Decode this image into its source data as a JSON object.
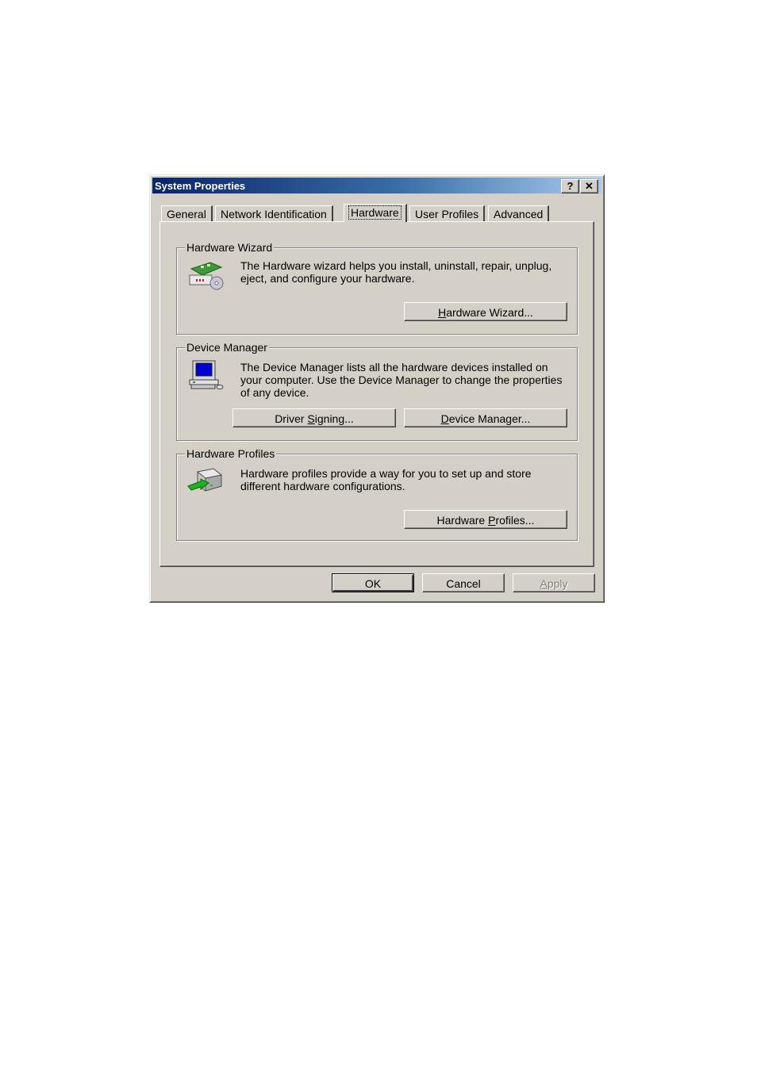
{
  "window": {
    "title": "System Properties",
    "help_button": "?",
    "close_button": "✕"
  },
  "tabs": [
    {
      "label": "General",
      "active": false
    },
    {
      "label": "Network Identification",
      "active": false
    },
    {
      "label": "Hardware",
      "active": true
    },
    {
      "label": "User Profiles",
      "active": false
    },
    {
      "label": "Advanced",
      "active": false
    }
  ],
  "groups": {
    "hardware_wizard": {
      "label": "Hardware Wizard",
      "icon": "hardware-wizard-icon",
      "text": "The Hardware wizard helps you install, uninstall, repair, unplug, eject, and configure your hardware.",
      "button_pre": "",
      "button_key": "H",
      "button_post": "ardware Wizard..."
    },
    "device_manager": {
      "label": "Device Manager",
      "icon": "computer-icon",
      "text": "The Device Manager lists all the hardware devices installed on your computer. Use the Device Manager to change the properties of any device.",
      "driver_pre": "Driver ",
      "driver_key": "S",
      "driver_post": "igning...",
      "dm_pre": "",
      "dm_key": "D",
      "dm_post": "evice Manager..."
    },
    "hardware_profiles": {
      "label": "Hardware Profiles",
      "icon": "hardware-profiles-icon",
      "text": "Hardware profiles provide a way for you to set up and store different hardware configurations.",
      "button_pre": "Hardware ",
      "button_key": "P",
      "button_post": "rofiles..."
    }
  },
  "footer": {
    "ok": "OK",
    "cancel": "Cancel",
    "apply_key": "A",
    "apply_post": "pply"
  }
}
